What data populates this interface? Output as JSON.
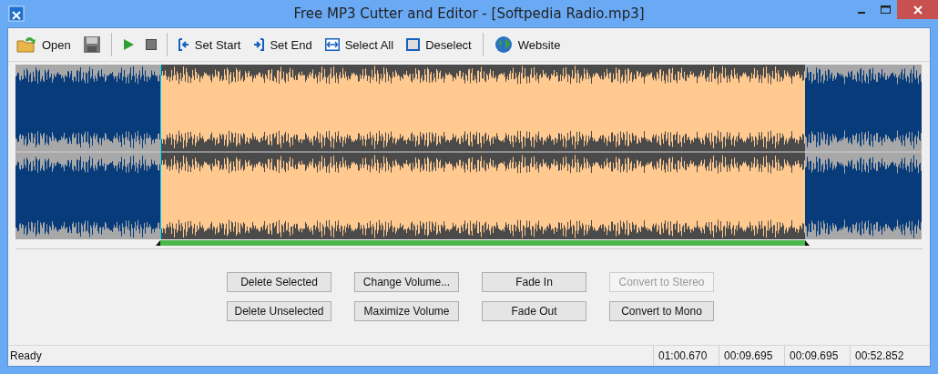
{
  "window": {
    "title": "Free MP3 Cutter and Editor - [Softpedia Radio.mp3]"
  },
  "toolbar": [
    {
      "kind": "open",
      "label": "Open"
    },
    {
      "kind": "save"
    },
    {
      "kind": "separator"
    },
    {
      "kind": "play"
    },
    {
      "kind": "stop"
    },
    {
      "kind": "separator"
    },
    {
      "kind": "set-start",
      "label": "Set Start"
    },
    {
      "kind": "set-end",
      "label": "Set End"
    },
    {
      "kind": "select-all",
      "label": "Select All"
    },
    {
      "kind": "deselect",
      "label": "Deselect"
    },
    {
      "kind": "separator"
    },
    {
      "kind": "website",
      "label": "Website"
    }
  ],
  "buttons": [
    {
      "label": "Delete Selected",
      "disabled": false
    },
    {
      "label": "Change Volume...",
      "disabled": false
    },
    {
      "label": "Fade In",
      "disabled": false
    },
    {
      "label": "Convert to Stereo",
      "disabled": true
    },
    {
      "label": "Delete Unselected",
      "disabled": false
    },
    {
      "label": "Maximize Volume",
      "disabled": false
    },
    {
      "label": "Fade Out",
      "disabled": false
    },
    {
      "label": "Convert to Mono",
      "disabled": false
    }
  ],
  "status_bar": {
    "message": "Ready",
    "times": [
      "01:00.670",
      "00:09.695",
      "00:09.695",
      "00:52.852"
    ]
  }
}
